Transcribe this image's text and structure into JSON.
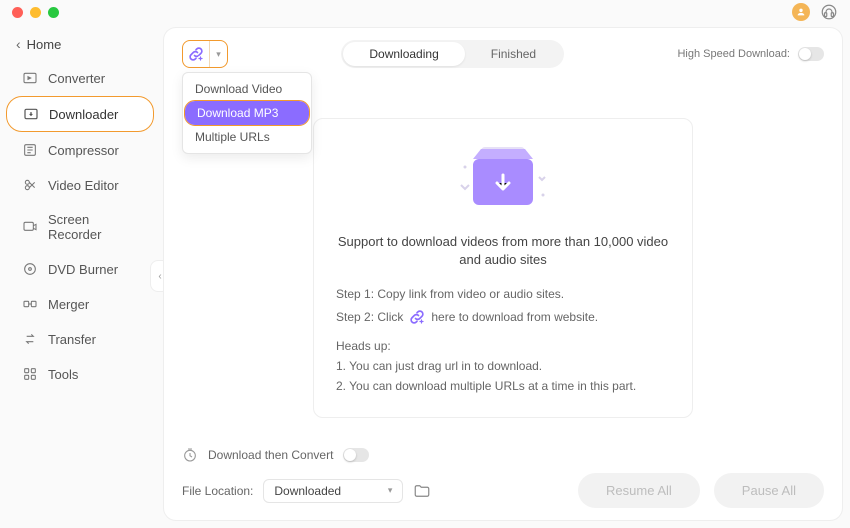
{
  "home_label": "Home",
  "sidebar": {
    "items": [
      {
        "label": "Converter"
      },
      {
        "label": "Downloader"
      },
      {
        "label": "Compressor"
      },
      {
        "label": "Video Editor"
      },
      {
        "label": "Screen Recorder"
      },
      {
        "label": "DVD Burner"
      },
      {
        "label": "Merger"
      },
      {
        "label": "Transfer"
      },
      {
        "label": "Tools"
      }
    ]
  },
  "dropdown": {
    "items": [
      {
        "label": "Download Video"
      },
      {
        "label": "Download MP3"
      },
      {
        "label": "Multiple URLs"
      }
    ]
  },
  "tabs": {
    "downloading": "Downloading",
    "finished": "Finished"
  },
  "speed_label": "High Speed Download:",
  "card": {
    "message": "Support to download videos from more than 10,000 video and audio sites",
    "step1": "Step 1: Copy link from video or audio sites.",
    "step2_pre": "Step 2: Click",
    "step2_post": "here to download from website.",
    "heads_up": "Heads up:",
    "heads1": "1. You can just drag url in to download.",
    "heads2": "2. You can download multiple URLs at a time in this part."
  },
  "bottom": {
    "convert_label": "Download then Convert",
    "file_location_label": "File Location:",
    "file_location_value": "Downloaded",
    "resume": "Resume All",
    "pause": "Pause All"
  }
}
